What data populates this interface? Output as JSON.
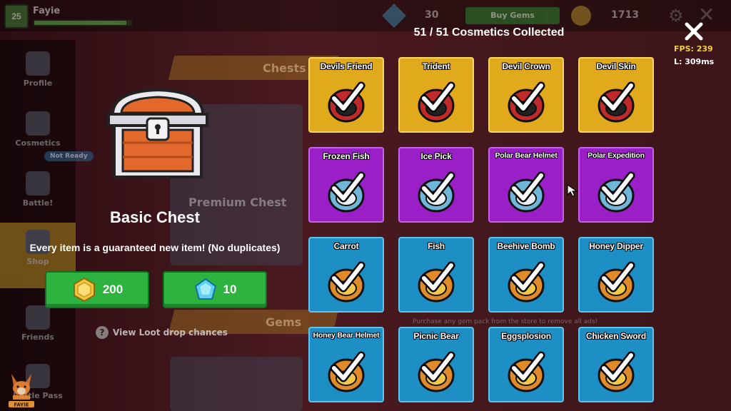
{
  "topbar": {
    "level": "25",
    "player_name": "Fayie",
    "xp_progress": 0.95,
    "gems": "30",
    "buy_gems_label": "Buy Gems",
    "coins": "1713"
  },
  "sidebar": {
    "items": [
      {
        "label": "Profile"
      },
      {
        "label": "Cosmetics"
      },
      {
        "label": "Battle!"
      },
      {
        "label": "Shop"
      },
      {
        "label": "Friends"
      },
      {
        "label": "Battle Pass"
      }
    ],
    "not_ready_badge": "Not Ready",
    "logo_text": "FAYIE"
  },
  "shop_bg": {
    "chests_banner": "Chests",
    "gems_banner": "Gems",
    "premium_chest_label": "Premium Chest",
    "ad_notice": "Purchase any gem pack from the store to remove all ads!"
  },
  "chest": {
    "title": "Basic Chest",
    "description": "Every item is a guaranteed new item! (No duplicates)",
    "price_coins": "200",
    "price_gems": "10",
    "view_loot": "View Loot drop chances"
  },
  "collection": {
    "header": "51 / 51 Cosmetics Collected",
    "fps": "FPS: 239",
    "latency": "L: 309ms",
    "items": [
      {
        "name": "Devils Friend",
        "rarity": "yellow",
        "icon": "devil-ball-icon"
      },
      {
        "name": "Trident",
        "rarity": "yellow",
        "icon": "trident-icon"
      },
      {
        "name": "Devil Crown",
        "rarity": "yellow",
        "icon": "devil-crown-icon"
      },
      {
        "name": "Devil Skin",
        "rarity": "yellow",
        "icon": "devil-skin-icon"
      },
      {
        "name": "Frozen Fish",
        "rarity": "purple",
        "icon": "frozen-fish-icon"
      },
      {
        "name": "Ice Pick",
        "rarity": "purple",
        "icon": "ice-pick-icon"
      },
      {
        "name": "Polar Bear Helmet",
        "rarity": "purple",
        "icon": "polar-bear-helmet-icon"
      },
      {
        "name": "Polar Expedition",
        "rarity": "purple",
        "icon": "polar-expedition-icon"
      },
      {
        "name": "Carrot",
        "rarity": "blue",
        "icon": "carrot-icon"
      },
      {
        "name": "Fish",
        "rarity": "blue",
        "icon": "fish-icon"
      },
      {
        "name": "Beehive Bomb",
        "rarity": "blue",
        "icon": "beehive-bomb-icon"
      },
      {
        "name": "Honey Dipper",
        "rarity": "blue",
        "icon": "honey-dipper-icon"
      },
      {
        "name": "Honey Bear Helmet",
        "rarity": "blue",
        "icon": "honey-bear-helmet-icon"
      },
      {
        "name": "Picnic Bear",
        "rarity": "blue",
        "icon": "picnic-bear-icon"
      },
      {
        "name": "Eggsplosion",
        "rarity": "blue",
        "icon": "eggsplosion-icon"
      },
      {
        "name": "Chicken Sword",
        "rarity": "blue",
        "icon": "chicken-sword-icon"
      }
    ]
  },
  "colors": {
    "yellow_card": "#e0aa1c",
    "purple_card": "#9a1fc6",
    "blue_card": "#1e8fc5",
    "buy_button": "#2fb340",
    "fps_text": "#f4d23c"
  }
}
